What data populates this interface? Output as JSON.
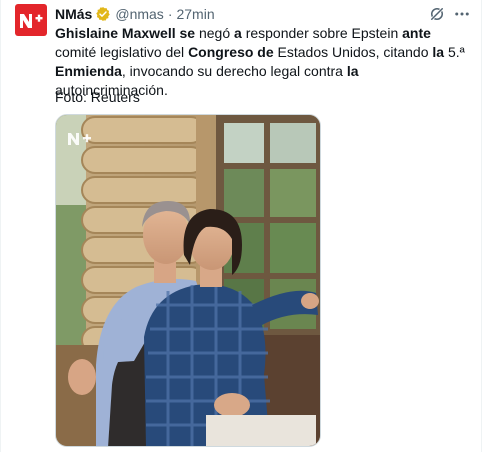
{
  "tweet": {
    "display_name": "NMás",
    "handle": "@nmas",
    "separator": "·",
    "time": "27min",
    "text_runs": [
      {
        "text": "Ghislaine Maxwell",
        "bold": true
      },
      {
        "text": " ",
        "bold": false
      },
      {
        "text": "se",
        "bold": true
      },
      {
        "text": " negó ",
        "bold": false
      },
      {
        "text": "a",
        "bold": true
      },
      {
        "text": " responder sobre Epstein ",
        "bold": false
      },
      {
        "text": "ante",
        "bold": true
      },
      {
        "text": " comité legislativo del ",
        "bold": false
      },
      {
        "text": "Congreso de",
        "bold": true
      },
      {
        "text": " Estados Unidos, citando ",
        "bold": false
      },
      {
        "text": "la",
        "bold": true
      },
      {
        "text": " 5.ª ",
        "bold": false
      },
      {
        "text": "Enmienda",
        "bold": true
      },
      {
        "text": ", invocando su derecho legal contra ",
        "bold": false
      },
      {
        "text": "la",
        "bold": true
      },
      {
        "text": " autoincriminación.",
        "bold": false
      }
    ],
    "caption": "Foto: Reuters"
  },
  "colors": {
    "brand_red": "#e3262b",
    "verified_gold": "#e2b719",
    "muted": "#536471"
  },
  "icons": {
    "avatar": "nmas-logo",
    "verified": "verified-badge-icon",
    "grok": "grok-icon",
    "more": "more-options-icon"
  }
}
